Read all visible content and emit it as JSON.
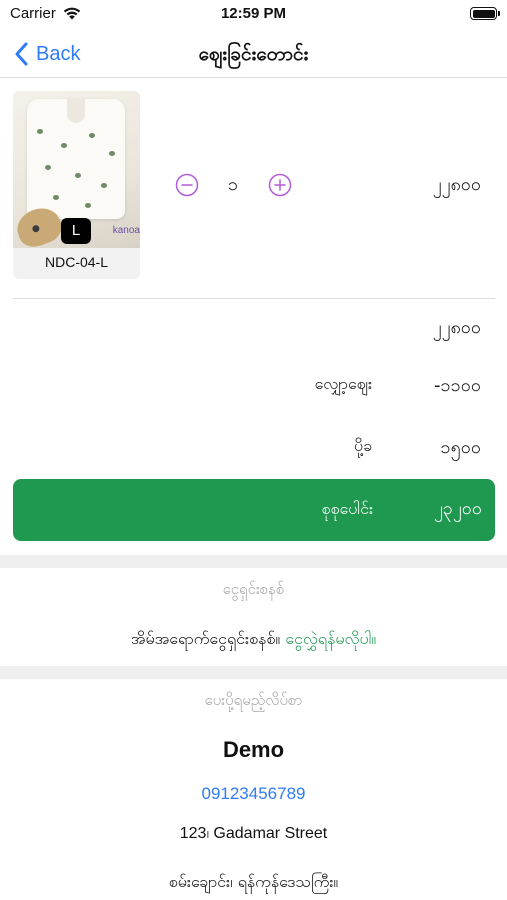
{
  "status_bar": {
    "carrier": "Carrier",
    "time": "12:59 PM"
  },
  "nav": {
    "back_label": "Back",
    "title": "ဈေးခြင်းတောင်း"
  },
  "cart_item": {
    "code": "NDC-04-L",
    "size_badge": "L",
    "brand_mark": "kanoa",
    "quantity": "၁",
    "price": "၂၂၈၀၀"
  },
  "summary": {
    "subtotal": "၂၂၈၀၀",
    "discount_label": "လျှော့ဈေး",
    "discount_value": "-၁၁၀၀",
    "shipping_label": "ပို့ခ",
    "shipping_value": "၁၅၀၀",
    "total_label": "စုစုပေါင်း",
    "total_value": "၂၃၂၀၀"
  },
  "payment": {
    "heading": "ငွေရှင်းစနစ်",
    "method": "အိမ်အရောက်ငွေရှင်းစနစ်။",
    "change_link": "ငွေလွှဲရန်မလိုပါ။"
  },
  "address": {
    "heading": "ပေးပို့ရမည့်လိပ်စာ",
    "name": "Demo",
    "phone": "09123456789",
    "street": "123၊ Gadamar Street",
    "township": "စမ်းချောင်း၊ ရန်ကုန်ဒေသကြီး။"
  },
  "colors": {
    "accent_blue": "#2f7cf6",
    "total_green": "#1f9850",
    "stepper_purple": "#b05cd6",
    "muted_gray": "#a7a7a7"
  },
  "icons": [
    "wifi-icon",
    "battery-icon",
    "chevron-left-icon",
    "minus-circle-icon",
    "plus-circle-icon"
  ]
}
